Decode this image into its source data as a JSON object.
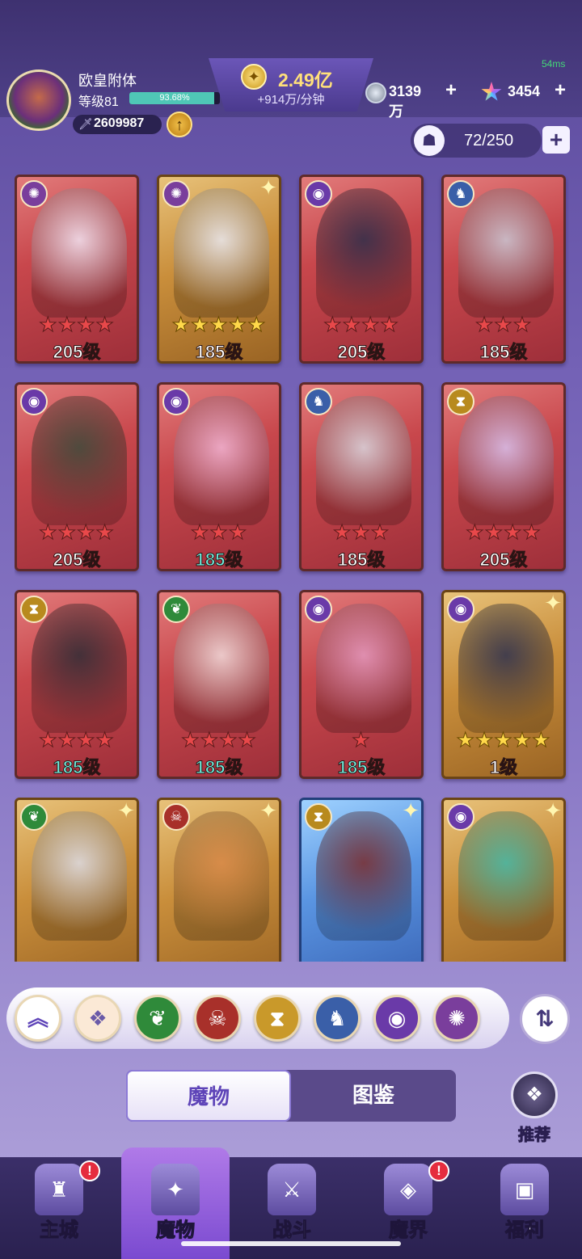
{
  "header": {
    "player_name": "欧皇附体",
    "level_label": "等级81",
    "exp_percent_text": "93.68%",
    "exp_fraction": 0.9368,
    "power_value": "2609987",
    "gold_value": "2.49亿",
    "gold_rate": "+914万/分钟",
    "silver_value": "3139万",
    "gem_value": "3454",
    "ping": "54ms",
    "capacity": "72/250"
  },
  "cards": [
    {
      "faction": "light",
      "bg": "red",
      "stars": "★★★★",
      "star_color": "red",
      "level": "205级",
      "level_color": "white"
    },
    {
      "faction": "light",
      "bg": "gold",
      "stars": "★★★★★",
      "star_color": "yellow",
      "level": "185级",
      "level_color": "white"
    },
    {
      "faction": "eye",
      "bg": "red",
      "stars": "★★★★",
      "star_color": "red",
      "level": "205级",
      "level_color": "white"
    },
    {
      "faction": "dragon",
      "bg": "red",
      "stars": "★★★",
      "star_color": "red",
      "level": "185级",
      "level_color": "white"
    },
    {
      "faction": "eye",
      "bg": "red",
      "stars": "★★★★",
      "star_color": "red",
      "level": "205级",
      "level_color": "white"
    },
    {
      "faction": "eye",
      "bg": "red",
      "stars": "★★★",
      "star_color": "red",
      "level": "185级",
      "level_color": "teal"
    },
    {
      "faction": "dragon",
      "bg": "red",
      "stars": "★★★",
      "star_color": "red",
      "level": "185级",
      "level_color": "white"
    },
    {
      "faction": "hourglass",
      "bg": "red",
      "stars": "★★★★",
      "star_color": "red",
      "level": "205级",
      "level_color": "white"
    },
    {
      "faction": "hourglass",
      "bg": "red",
      "stars": "★★★★",
      "star_color": "red",
      "level": "185级",
      "level_color": "teal"
    },
    {
      "faction": "nature",
      "bg": "red",
      "stars": "★★★★",
      "star_color": "red",
      "level": "185级",
      "level_color": "teal"
    },
    {
      "faction": "eye",
      "bg": "red",
      "stars": "★",
      "star_color": "red",
      "level": "185级",
      "level_color": "teal"
    },
    {
      "faction": "eye",
      "bg": "gold",
      "stars": "★★★★★",
      "star_color": "yellow",
      "level": "1级",
      "level_color": "white"
    },
    {
      "faction": "nature",
      "bg": "gold",
      "stars": "★★★★★",
      "star_color": "yellow",
      "level": "",
      "level_color": "white"
    },
    {
      "faction": "demon",
      "bg": "gold",
      "stars": "★★★★★",
      "star_color": "yellow",
      "level": "",
      "level_color": "white"
    },
    {
      "faction": "hourglass",
      "bg": "blue",
      "stars": "★★★",
      "star_color": "yellow",
      "level": "",
      "level_color": "white"
    },
    {
      "faction": "eye",
      "bg": "gold",
      "stars": "★★★★★",
      "star_color": "yellow",
      "level": "",
      "level_color": "white"
    }
  ],
  "filters": [
    {
      "name": "collapse",
      "icon": "double-chevron-up-icon"
    },
    {
      "name": "all",
      "icon": "diamond-grid-icon"
    },
    {
      "name": "nature",
      "icon": "leaf-icon"
    },
    {
      "name": "demon",
      "icon": "demon-mask-icon"
    },
    {
      "name": "hourglass",
      "icon": "hourglass-icon"
    },
    {
      "name": "dragon",
      "icon": "dragon-icon"
    },
    {
      "name": "eye",
      "icon": "eye-icon"
    },
    {
      "name": "light",
      "icon": "swirl-icon"
    }
  ],
  "tabs": {
    "monsters": "魔物",
    "codex": "图鉴"
  },
  "recommend_label": "推荐",
  "nav": [
    {
      "label": "主城",
      "badge": "!"
    },
    {
      "label": "魔物",
      "badge": ""
    },
    {
      "label": "战斗",
      "badge": ""
    },
    {
      "label": "魔界",
      "badge": "!"
    },
    {
      "label": "福利",
      "badge": ""
    }
  ],
  "colors": {
    "accent_purple": "#5e44b8",
    "gold_text": "#ffe07a",
    "exp_fill": "#4fc7b6",
    "star_red": "#e8484a",
    "star_yellow": "#ffd84a"
  }
}
